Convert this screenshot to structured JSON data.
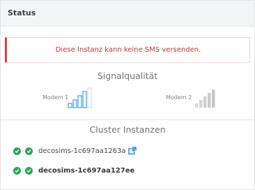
{
  "header": {
    "title": "Status"
  },
  "alert": {
    "message": "Diese Instanz kann keine SMS versenden.",
    "color": "#d9413b"
  },
  "signal": {
    "title": "Signalqualität",
    "modems": [
      {
        "label": "Modem 1",
        "bars_active": 4,
        "bars_total": 5,
        "state": "outline"
      },
      {
        "label": "Modem 2",
        "bars_active": 0,
        "bars_total": 5,
        "state": "grey"
      }
    ],
    "active_color": "#1e88e5",
    "inactive_color": "#cfcfcf"
  },
  "cluster": {
    "title": "Cluster Instanzen",
    "instances": [
      {
        "name": "decosims-1c697aa1263a",
        "has_link": true,
        "link_icon": "external-link-icon"
      },
      {
        "name": "decosims-1c697aa127ee",
        "has_link": false
      }
    ],
    "status_color": "#2aa85a"
  }
}
